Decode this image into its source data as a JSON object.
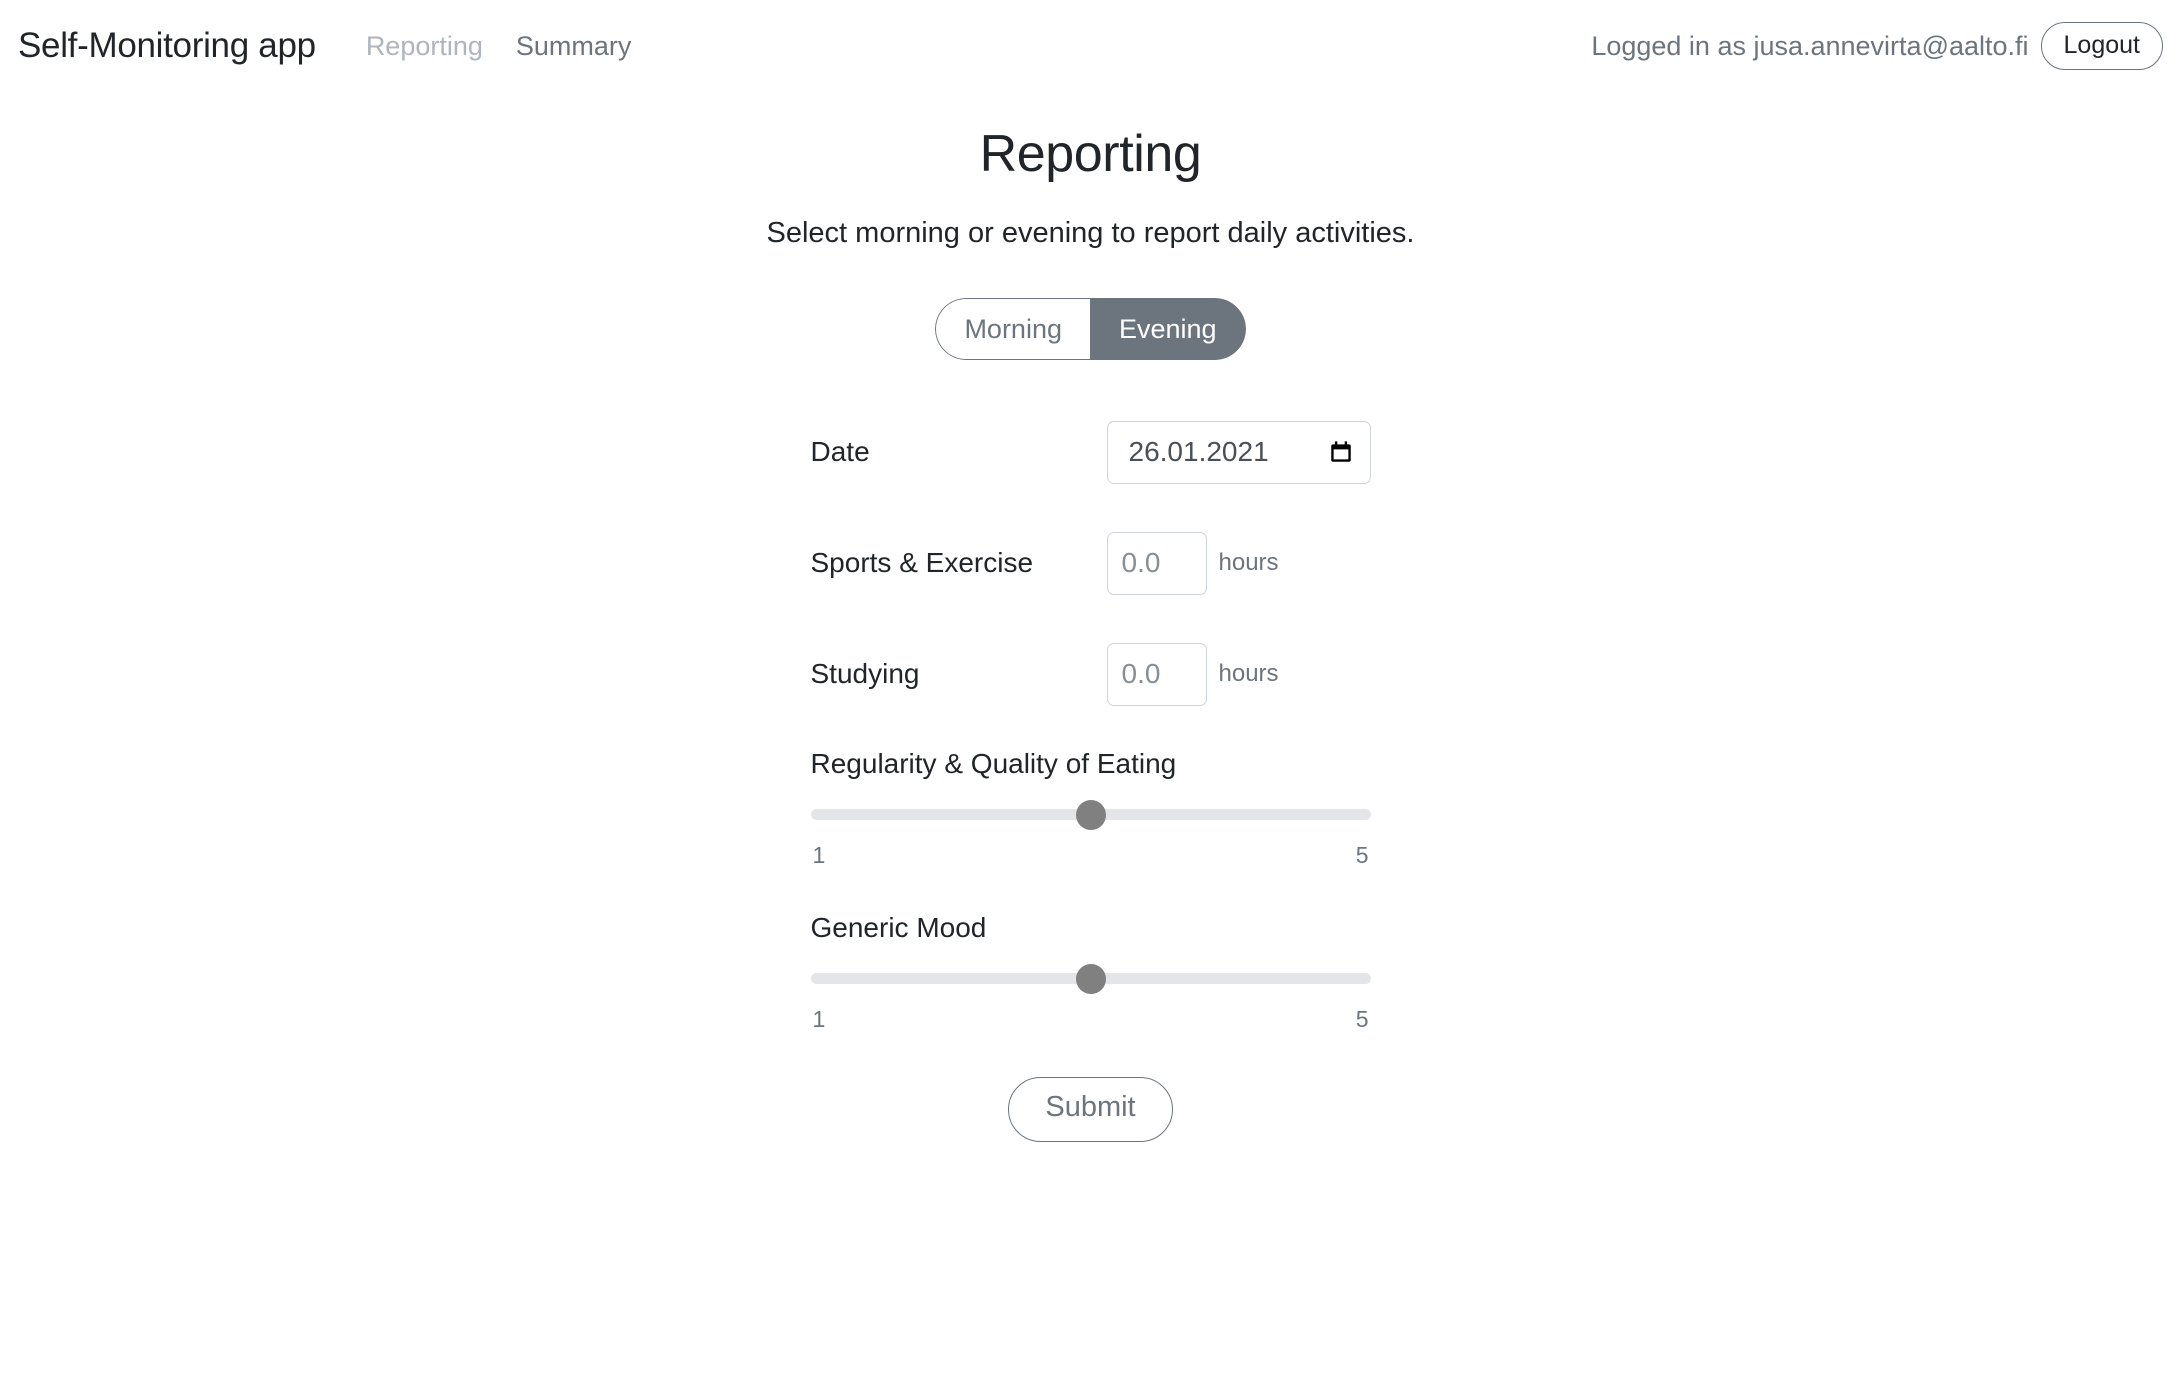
{
  "header": {
    "brand": "Self-Monitoring app",
    "nav": [
      {
        "label": "Reporting",
        "name": "nav-link-reporting",
        "active": true
      },
      {
        "label": "Summary",
        "name": "nav-link-summary",
        "active": false
      }
    ],
    "logged_in_text": "Logged in as jusa.annevirta@aalto.fi",
    "logout_label": "Logout"
  },
  "main": {
    "title": "Reporting",
    "subtitle": "Select morning or evening to report daily activities.",
    "toggle": {
      "options": [
        {
          "label": "Morning",
          "selected": false
        },
        {
          "label": "Evening",
          "selected": true
        }
      ],
      "selected_value": "Evening"
    },
    "fields": {
      "date": {
        "label": "Date",
        "value": "26.01.2021",
        "icon": "calendar-icon"
      },
      "sports": {
        "label": "Sports & Exercise",
        "placeholder": "0.0",
        "value": "",
        "unit": "hours"
      },
      "studying": {
        "label": "Studying",
        "placeholder": "0.0",
        "value": "",
        "unit": "hours"
      }
    },
    "sliders": [
      {
        "label": "Regularity & Quality of Eating",
        "min_label": "1",
        "max_label": "5",
        "min": 1,
        "max": 5,
        "value": 3,
        "thumb_percent": "50%"
      },
      {
        "label": "Generic Mood",
        "min_label": "1",
        "max_label": "5",
        "min": 1,
        "max": 5,
        "value": 3,
        "thumb_percent": "50%"
      }
    ],
    "submit_label": "Submit"
  },
  "colors": {
    "accent_selected": "#6c757d",
    "text_primary": "#212529",
    "text_muted": "#6c757d",
    "border": "#ced4da",
    "slider_track": "#e3e5e8",
    "slider_thumb": "#808080"
  }
}
